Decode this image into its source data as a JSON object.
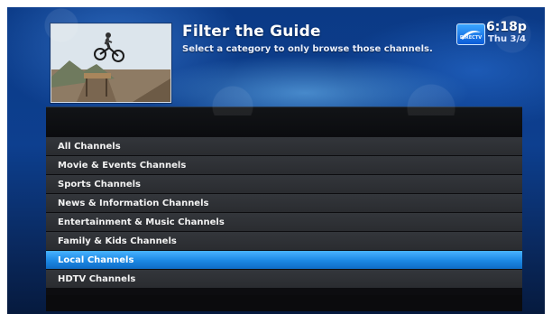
{
  "header": {
    "title": "Filter the Guide",
    "subtitle": "Select a category to only browse those channels.",
    "logo_text": "DIRECTV",
    "time": "6:18p",
    "date": "Thu 3/4"
  },
  "thumbnail": {
    "icon": "bmx-rider-thumbnail"
  },
  "categories": [
    {
      "label": "All Channels",
      "selected": false
    },
    {
      "label": "Movie & Events Channels",
      "selected": false
    },
    {
      "label": "Sports Channels",
      "selected": false
    },
    {
      "label": "News & Information Channels",
      "selected": false
    },
    {
      "label": "Entertainment & Music Channels",
      "selected": false
    },
    {
      "label": "Family & Kids Channels",
      "selected": false
    },
    {
      "label": "Local Channels",
      "selected": true
    },
    {
      "label": "HDTV Channels",
      "selected": false
    }
  ],
  "colors": {
    "selected_row": "#1c88e3",
    "row": "#2f3236",
    "background": "#0d3f8f"
  }
}
